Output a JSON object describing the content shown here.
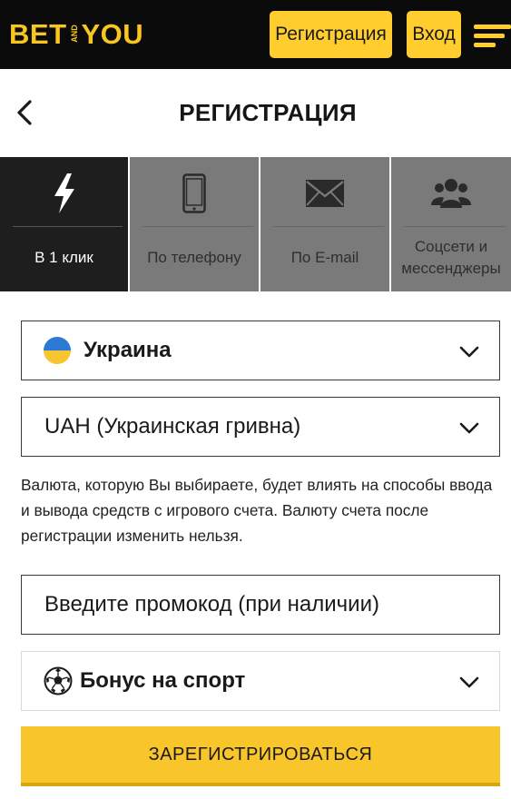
{
  "header": {
    "logo_left": "BET",
    "logo_middle": "AND",
    "logo_right": "YOU",
    "register_label": "Регистрация",
    "login_label": "Вход",
    "accent_color": "#ffcd2e"
  },
  "page": {
    "title": "РЕГИСТРАЦИЯ"
  },
  "tabs": [
    {
      "label": "В 1 клик",
      "icon": "lightning-icon",
      "active": true
    },
    {
      "label": "По телефону",
      "icon": "phone-icon",
      "active": false
    },
    {
      "label": "По E-mail",
      "icon": "envelope-icon",
      "active": false
    },
    {
      "label": "Соцсети и мессенджеры",
      "icon": "users-icon",
      "active": false
    }
  ],
  "form": {
    "country_value": "Украина",
    "currency_value": "UAH (Украинская гривна)",
    "currency_hint": "Валюта, которую Вы выбираете, будет влиять на способы ввода и вывода средств с игрового счета. Валюту счета после регистрации изменить нельзя.",
    "promo_placeholder": "Введите промокод (при наличии)",
    "bonus_value": "Бонус на спорт",
    "submit_label": "ЗАРЕГИСТРИРОВАТЬСЯ"
  }
}
